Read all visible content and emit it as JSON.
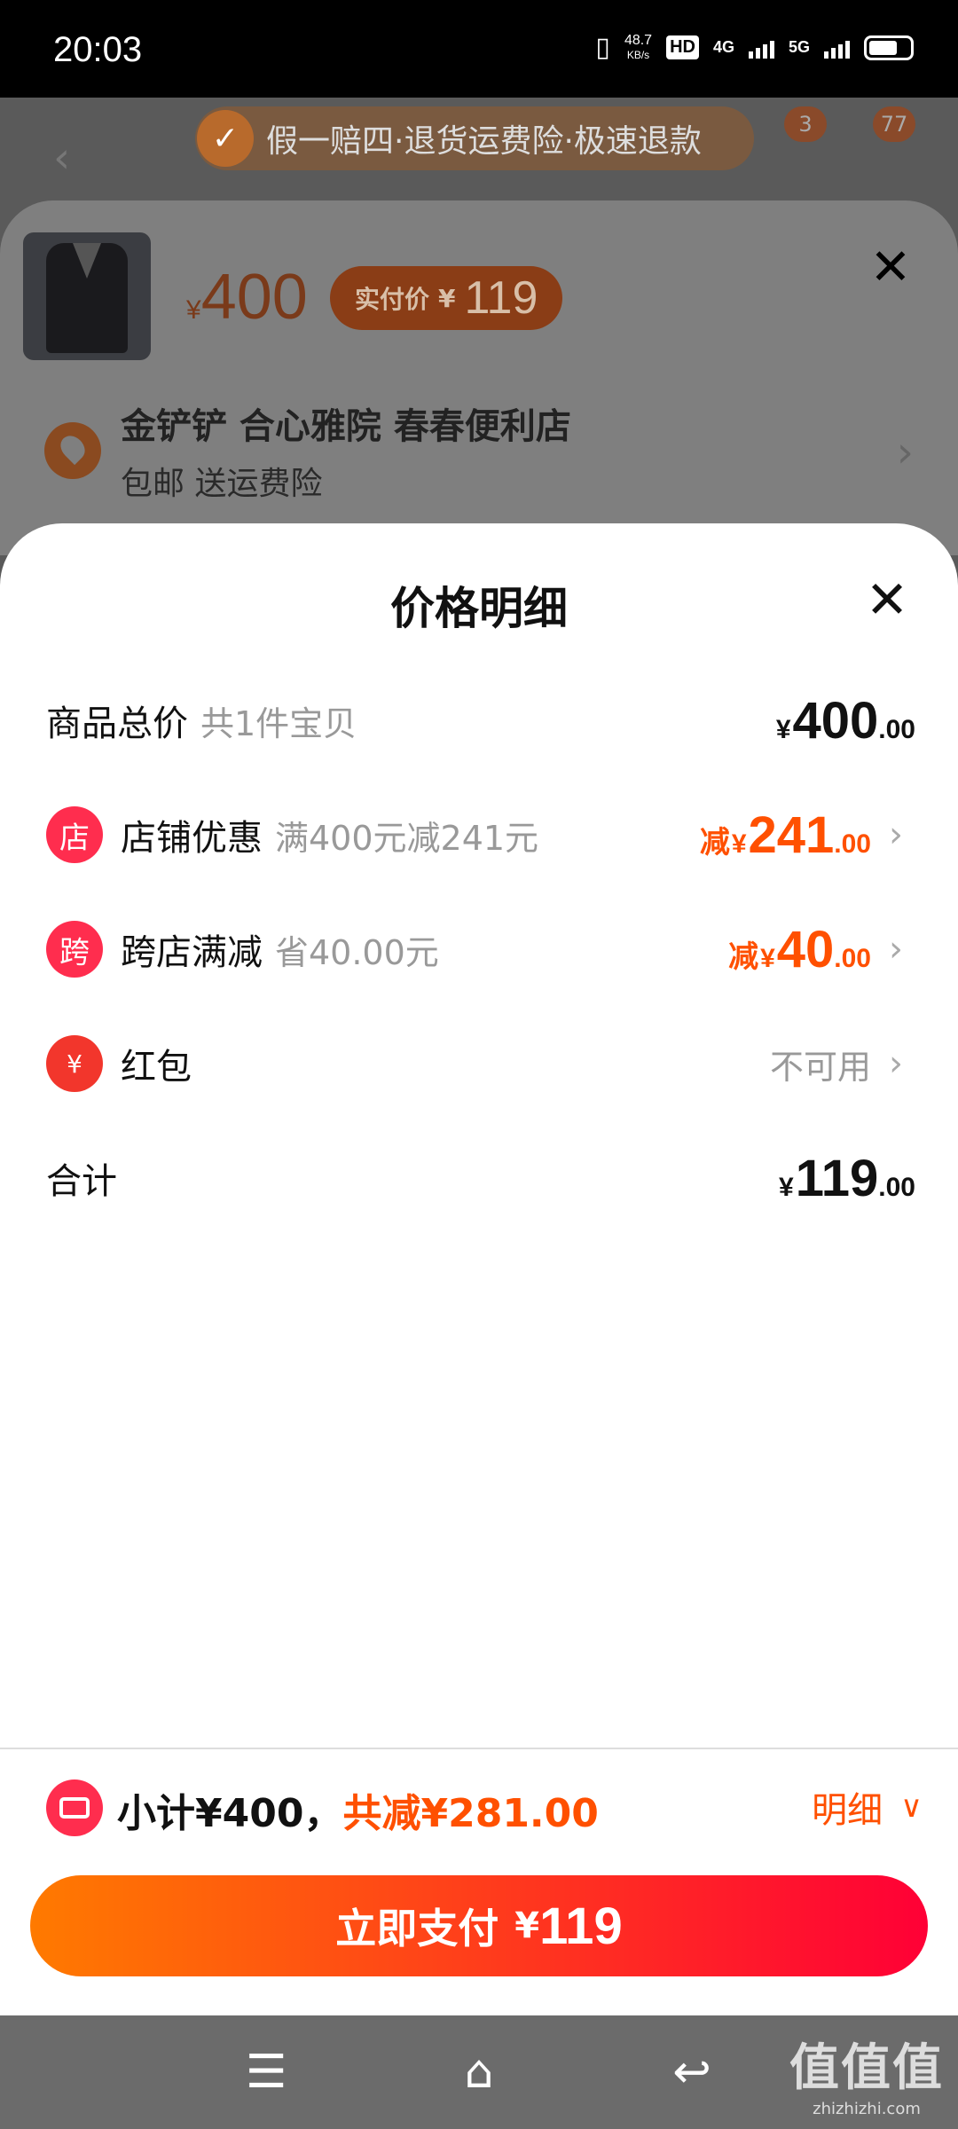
{
  "status_bar": {
    "time": "20:03",
    "speed_value": "48.7",
    "speed_unit": "KB/s",
    "hd": "HD",
    "net1": "4G",
    "net2": "5G",
    "battery_percent": 0.7
  },
  "background_page": {
    "guarantee_text": "假一赔四·退货运费险·极速退款",
    "cart_badge": "3",
    "msg_badge": "77"
  },
  "sku_panel": {
    "price_symbol": "¥",
    "price": "400",
    "pay_label": "实付价",
    "pay_symbol": "¥",
    "pay_price": "119",
    "address_name": "金铲铲 合心雅院 春春便利店",
    "address_sub": "包邮 送运费险"
  },
  "detail": {
    "title": "价格明细",
    "rows": [
      {
        "name": "商品总价",
        "sub": "共1件宝贝",
        "prefix": "",
        "yen": "¥",
        "int": "400",
        "dec": ".00"
      },
      {
        "icon": "店",
        "name": "店铺优惠",
        "sub": "满400元减241元",
        "prefix": "减",
        "yen": "¥",
        "int": "241",
        "dec": ".00"
      },
      {
        "icon": "跨",
        "name": "跨店满减",
        "sub": "省40.00元",
        "prefix": "减",
        "yen": "¥",
        "int": "40",
        "dec": ".00"
      },
      {
        "icon": "¥",
        "name": "红包",
        "status": "不可用"
      },
      {
        "name": "合计",
        "yen": "¥",
        "int": "119",
        "dec": ".00"
      }
    ]
  },
  "bottom": {
    "subtotal_label": "小计¥400，",
    "discount_label": "共减¥281.00",
    "detail_toggle": "明细",
    "pay_button": "立即支付",
    "pay_yen": "¥",
    "pay_amount": "119"
  },
  "nav": {
    "watermark": "值值值",
    "watermark_url": "zhizhizhi.com"
  },
  "colors": {
    "accent": "#ff5000",
    "icon_red": "#ff2d4e",
    "button_start": "#ff7a00",
    "button_end": "#ff0036"
  }
}
